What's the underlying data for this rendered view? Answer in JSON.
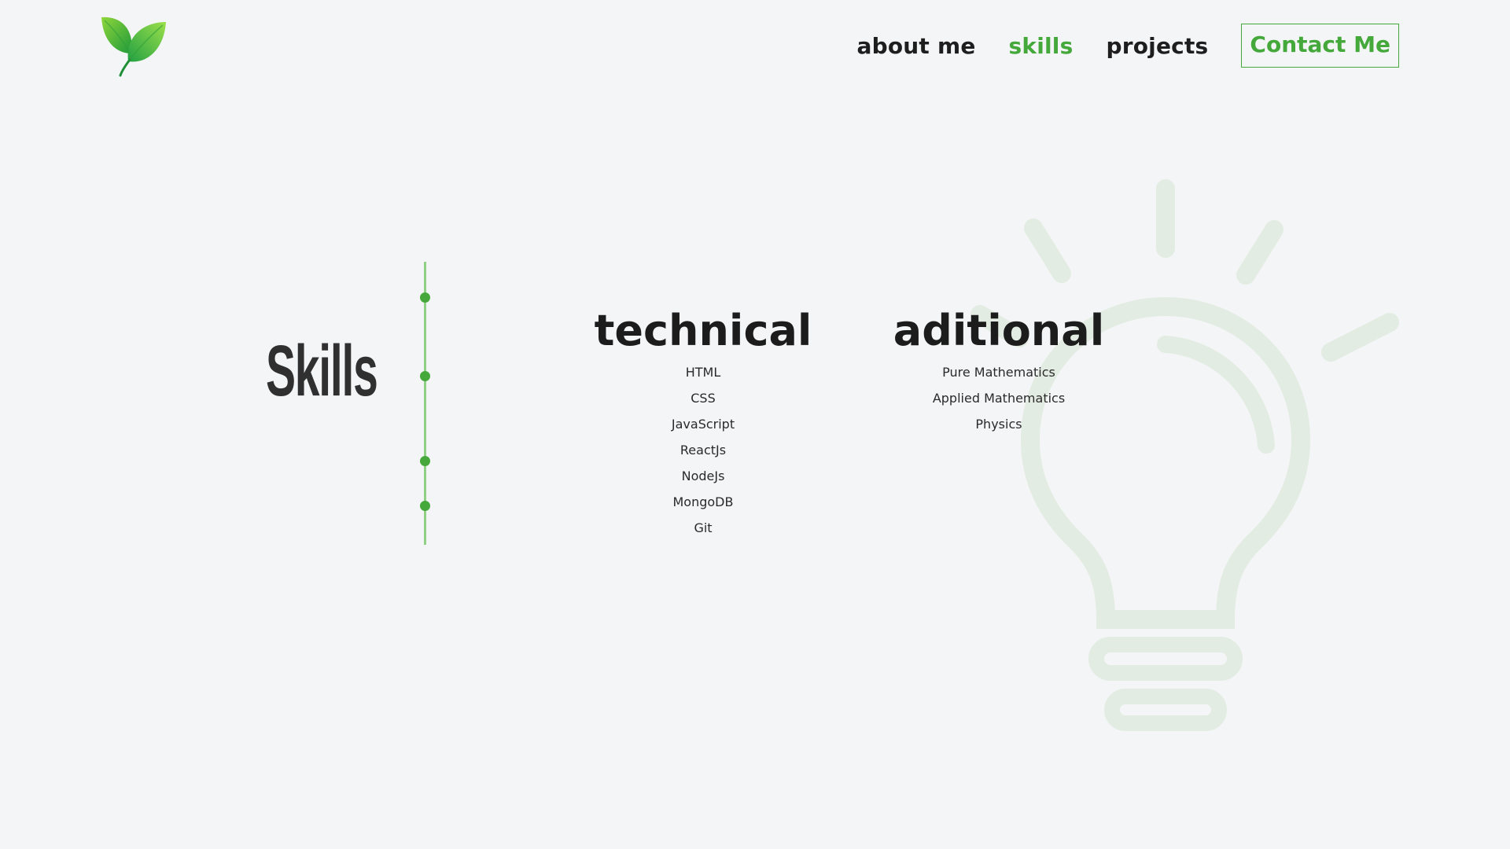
{
  "brand": {
    "logo_icon": "leaf-icon",
    "accent_color": "#44a83b"
  },
  "nav": {
    "items": [
      {
        "label": "about me",
        "active": false
      },
      {
        "label": "skills",
        "active": true
      },
      {
        "label": "projects",
        "active": false
      }
    ],
    "contact_label": "Contact Me"
  },
  "section": {
    "title": "Skills",
    "background_icon": "lightbulb-icon"
  },
  "columns": {
    "technical": {
      "heading": "technical",
      "items": [
        "HTML",
        "CSS",
        "JavaScript",
        "ReactJs",
        "NodeJs",
        "MongoDB",
        "Git"
      ]
    },
    "additional": {
      "heading": "aditional",
      "items": [
        "Pure Mathematics",
        "Applied Mathematics",
        "Physics"
      ]
    }
  }
}
